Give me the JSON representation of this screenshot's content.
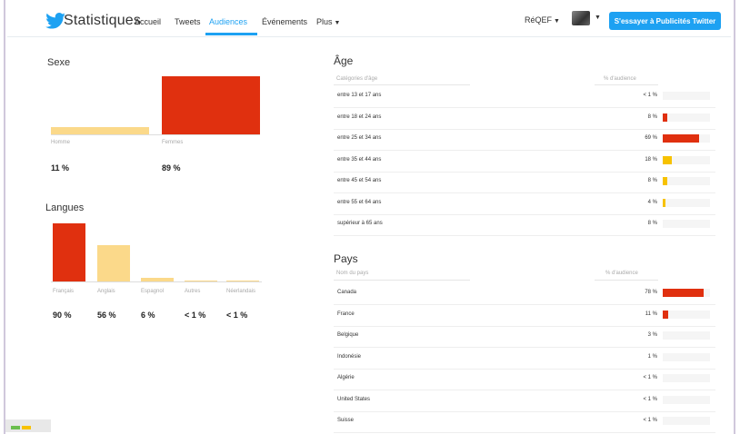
{
  "nav": {
    "brand": "Statistiques",
    "items": [
      "Accueil",
      "Tweets",
      "Audiences",
      "Événements",
      "Plus"
    ],
    "active": "Audiences",
    "account": "RéQEF",
    "cta": "S'essayer à Publicités Twitter"
  },
  "colors": {
    "red": "#e0300f",
    "yellow": "#f7c200",
    "ltyellow": "#fbd98a",
    "blue": "#1da1f2"
  },
  "sexe": {
    "title": "Sexe",
    "items": [
      {
        "label": "Homme",
        "pct": "11 %",
        "value": 11
      },
      {
        "label": "Femmes",
        "pct": "89 %",
        "value": 89
      }
    ]
  },
  "langues": {
    "title": "Langues",
    "items": [
      {
        "label": "Français",
        "pct": "90 %",
        "value": 90
      },
      {
        "label": "Anglais",
        "pct": "56 %",
        "value": 56
      },
      {
        "label": "Espagnol",
        "pct": "6 %",
        "value": 6
      },
      {
        "label": "Autres",
        "pct": "< 1 %",
        "value": 0.5
      },
      {
        "label": "Néerlandais",
        "pct": "< 1 %",
        "value": 0.5
      }
    ]
  },
  "age": {
    "title": "Âge",
    "col1": "Catégories d'âge",
    "col2": "% d'audience",
    "rows": [
      {
        "label": "entre 13 et 17 ans",
        "pct": "< 1 %",
        "value": 0
      },
      {
        "label": "entre 18 et 24 ans",
        "pct": "8 %",
        "value": 8
      },
      {
        "label": "entre 25 et 34 ans",
        "pct": "69 %",
        "value": 69
      },
      {
        "label": "entre 35 et 44 ans",
        "pct": "18 %",
        "value": 18
      },
      {
        "label": "entre 45 et 54 ans",
        "pct": "8 %",
        "value": 8
      },
      {
        "label": "entre 55 et 64 ans",
        "pct": "4 %",
        "value": 4
      },
      {
        "label": "supérieur à 65 ans",
        "pct": "8 %",
        "value": 0
      }
    ]
  },
  "pays": {
    "title": "Pays",
    "col1": "Nom du pays",
    "col2": "% d'audience",
    "rows": [
      {
        "label": "Canada",
        "pct": "78 %",
        "value": 78
      },
      {
        "label": "France",
        "pct": "11 %",
        "value": 11
      },
      {
        "label": "Belgique",
        "pct": "3 %",
        "value": 0
      },
      {
        "label": "Indonésie",
        "pct": "1 %",
        "value": 0
      },
      {
        "label": "Algérie",
        "pct": "< 1 %",
        "value": 0
      },
      {
        "label": "United States",
        "pct": "< 1 %",
        "value": 0
      },
      {
        "label": "Suisse",
        "pct": "< 1 %",
        "value": 0
      }
    ]
  }
}
